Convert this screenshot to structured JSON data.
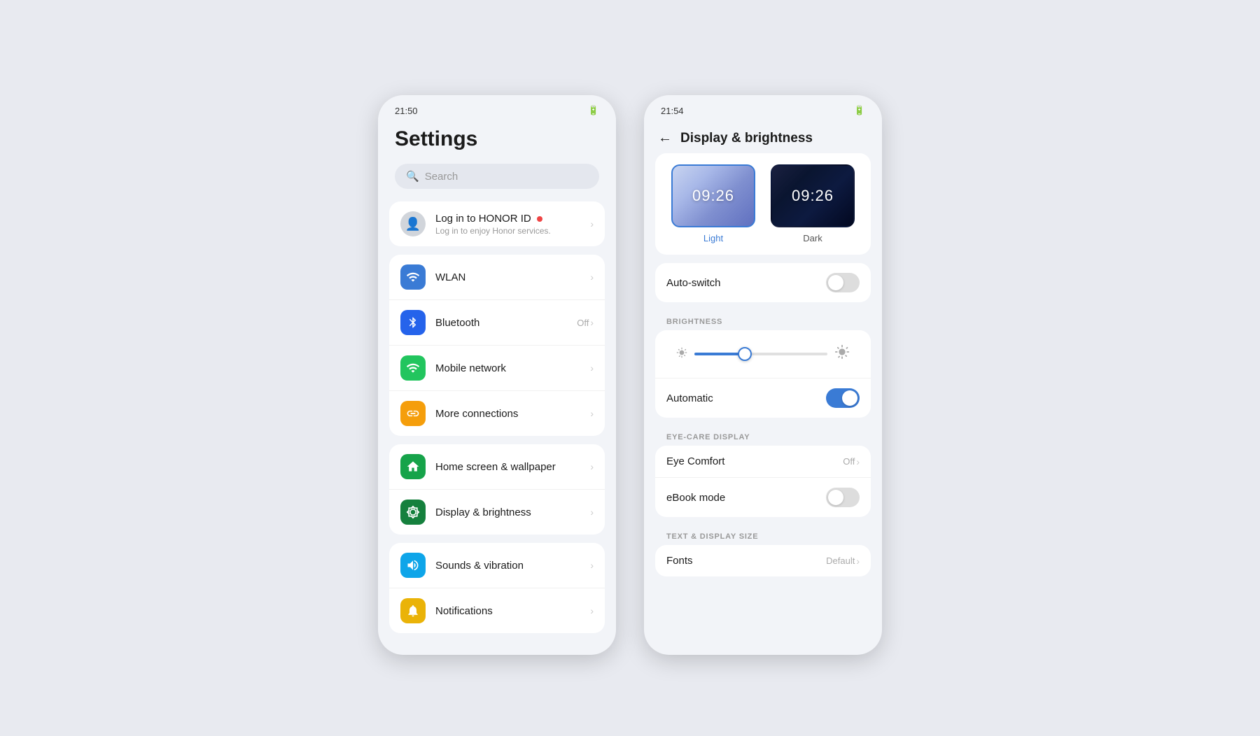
{
  "leftPhone": {
    "statusBar": {
      "time": "21:50",
      "batteryIcon": "🔋"
    },
    "title": "Settings",
    "search": {
      "placeholder": "Search"
    },
    "accountCard": {
      "title": "Log in to HONOR ID",
      "subtitle": "Log in to enjoy Honor services.",
      "hasDot": true
    },
    "networkGroup": [
      {
        "id": "wlan",
        "label": "WLAN",
        "iconColor": "icon-blue",
        "iconSymbol": "📶",
        "rightText": ""
      },
      {
        "id": "bluetooth",
        "label": "Bluetooth",
        "iconColor": "icon-blue2",
        "iconSymbol": "⬡",
        "rightText": "Off"
      },
      {
        "id": "mobile-network",
        "label": "Mobile network",
        "iconColor": "icon-green",
        "iconSymbol": "📶",
        "rightText": ""
      },
      {
        "id": "more-connections",
        "label": "More connections",
        "iconColor": "icon-orange",
        "iconSymbol": "🔗",
        "rightText": ""
      }
    ],
    "displayGroup": [
      {
        "id": "home-screen",
        "label": "Home screen & wallpaper",
        "iconColor": "icon-green2",
        "iconSymbol": "🖼",
        "rightText": ""
      },
      {
        "id": "display-brightness",
        "label": "Display & brightness",
        "iconColor": "icon-green3",
        "iconSymbol": "☀",
        "rightText": ""
      }
    ],
    "audioGroup": [
      {
        "id": "sounds",
        "label": "Sounds & vibration",
        "iconColor": "icon-teal",
        "iconSymbol": "🔊",
        "rightText": ""
      },
      {
        "id": "notifications",
        "label": "Notifications",
        "iconColor": "icon-yellow",
        "iconSymbol": "🔔",
        "rightText": ""
      }
    ]
  },
  "rightPhone": {
    "statusBar": {
      "time": "21:54",
      "batteryIcon": "🔋"
    },
    "header": {
      "backLabel": "←",
      "title": "Display & brightness"
    },
    "themes": [
      {
        "id": "light",
        "time": "09:26",
        "label": "Light",
        "selected": true
      },
      {
        "id": "dark",
        "time": "09:26",
        "label": "Dark",
        "selected": false
      }
    ],
    "autoSwitch": {
      "label": "Auto-switch",
      "enabled": false
    },
    "brightnessSection": {
      "header": "BRIGHTNESS",
      "sliderValue": 38,
      "automaticLabel": "Automatic",
      "automaticEnabled": true
    },
    "eyeCareSection": {
      "header": "EYE-CARE DISPLAY",
      "eyeComfortLabel": "Eye Comfort",
      "eyeComfortValue": "Off",
      "eBookLabel": "eBook mode",
      "eBookEnabled": false
    },
    "textDisplaySection": {
      "header": "TEXT & DISPLAY SIZE",
      "fontsLabel": "Fonts",
      "fontsValue": "Default"
    }
  }
}
